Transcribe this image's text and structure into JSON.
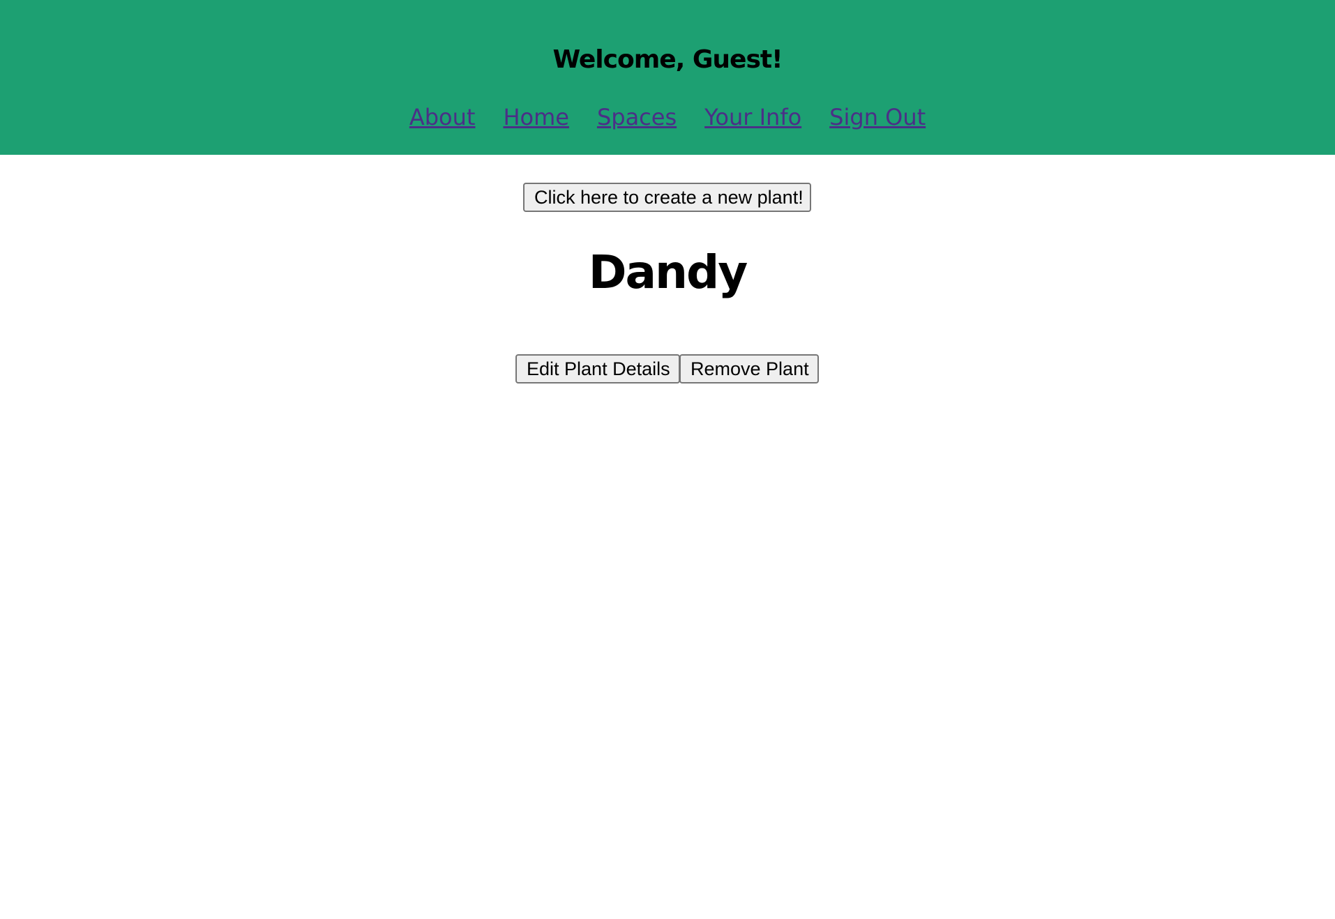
{
  "header": {
    "welcome": "Welcome, Guest!",
    "nav": [
      {
        "label": "About"
      },
      {
        "label": "Home"
      },
      {
        "label": "Spaces"
      },
      {
        "label": "Your Info"
      },
      {
        "label": "Sign Out"
      }
    ],
    "background_color": "#1da072",
    "link_color": "#4b2f87"
  },
  "main": {
    "create_button": "Click here to create a new plant!",
    "plant_name": "Dandy",
    "edit_button": "Edit Plant Details",
    "remove_button": "Remove Plant"
  }
}
